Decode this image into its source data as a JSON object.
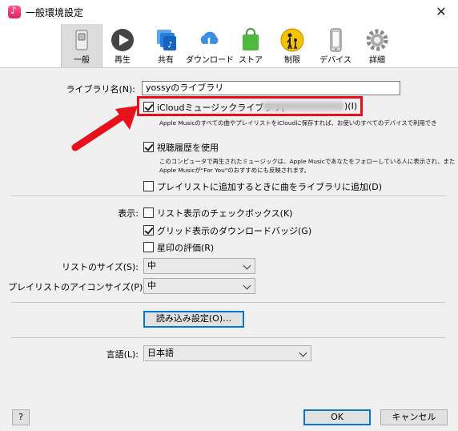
{
  "window": {
    "title": "一般環境設定",
    "close": "✕"
  },
  "toolbar": {
    "items": [
      {
        "label": "一般",
        "icon": "switch-icon"
      },
      {
        "label": "再生",
        "icon": "play-icon"
      },
      {
        "label": "共有",
        "icon": "share-icon"
      },
      {
        "label": "ダウンロード",
        "icon": "download-icon"
      },
      {
        "label": "ストア",
        "icon": "store-icon"
      },
      {
        "label": "制限",
        "icon": "parental-icon"
      },
      {
        "label": "デバイス",
        "icon": "device-icon"
      },
      {
        "label": "詳細",
        "icon": "gear-icon"
      }
    ]
  },
  "library": {
    "label": "ライブラリ名(N):",
    "value": "yossyのライブラリ"
  },
  "icloud": {
    "label_prefix": "iCloudミュージックライブラリ(",
    "label_suffix": ")(I)",
    "checked": true,
    "desc": "Apple Musicのすべての曲やプレイリストをiCloudに保存すれば、お使いのすべてのデバイスで利用でき"
  },
  "history": {
    "label": "視聴履歴を使用",
    "checked": true,
    "desc_line1": "このコンピュータで再生されたミュージックは、Apple Musicであなたをフォローしている人に表示され、また",
    "desc_line2": "Apple Musicが\"For You\"のおすすめにも反映されます。"
  },
  "add_to_library": {
    "label": "プレイリストに追加するときに曲をライブラリに追加(D)",
    "checked": false
  },
  "display": {
    "label": "表示:",
    "options": [
      {
        "label": "リスト表示のチェックボックス(K)",
        "checked": false
      },
      {
        "label": "グリッド表示のダウンロードバッジ(G)",
        "checked": true
      },
      {
        "label": "星印の評価(R)",
        "checked": false
      }
    ]
  },
  "list_size": {
    "label": "リストのサイズ(S):",
    "value": "中"
  },
  "playlist_icon_size": {
    "label": "プレイリストのアイコンサイズ(P):",
    "value": "中"
  },
  "import_button": "読み込み設定(O)…",
  "language": {
    "label": "言語(L):",
    "value": "日本語"
  },
  "footer": {
    "help": "?",
    "ok": "OK",
    "cancel": "キャンセル"
  },
  "colors": {
    "highlight": "#e8101a",
    "focus": "#0078d7"
  }
}
